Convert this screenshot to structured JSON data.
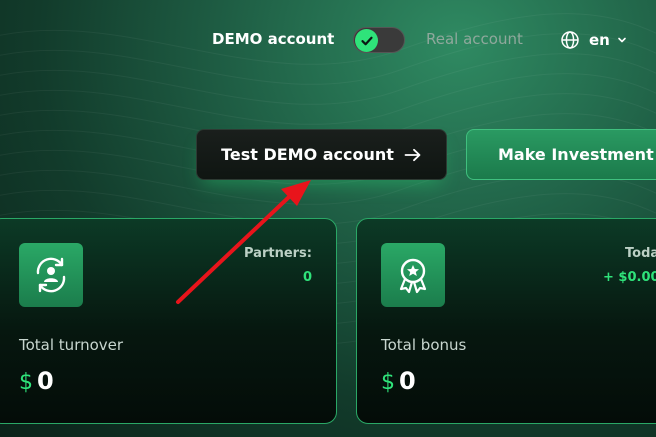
{
  "header": {
    "demo_label": "DEMO account",
    "real_label": "Real account",
    "language": "en",
    "toggle_checked": true
  },
  "buttons": {
    "test_demo": "Test DEMO account",
    "make_investment": "Make Investment"
  },
  "cards": [
    {
      "label": "Total turnover",
      "currency": "$",
      "amount": "0",
      "top_label": "Partners:",
      "top_value": "0",
      "icon": "users-cycle-icon"
    },
    {
      "label": "Total bonus",
      "currency": "$",
      "amount": "0",
      "top_label": "Toda",
      "top_value": "+ $0.00",
      "icon": "award-badge-icon"
    }
  ],
  "colors": {
    "accent": "#2fe37a",
    "card_border": "#2aa866",
    "annotation": "#e8141b"
  }
}
